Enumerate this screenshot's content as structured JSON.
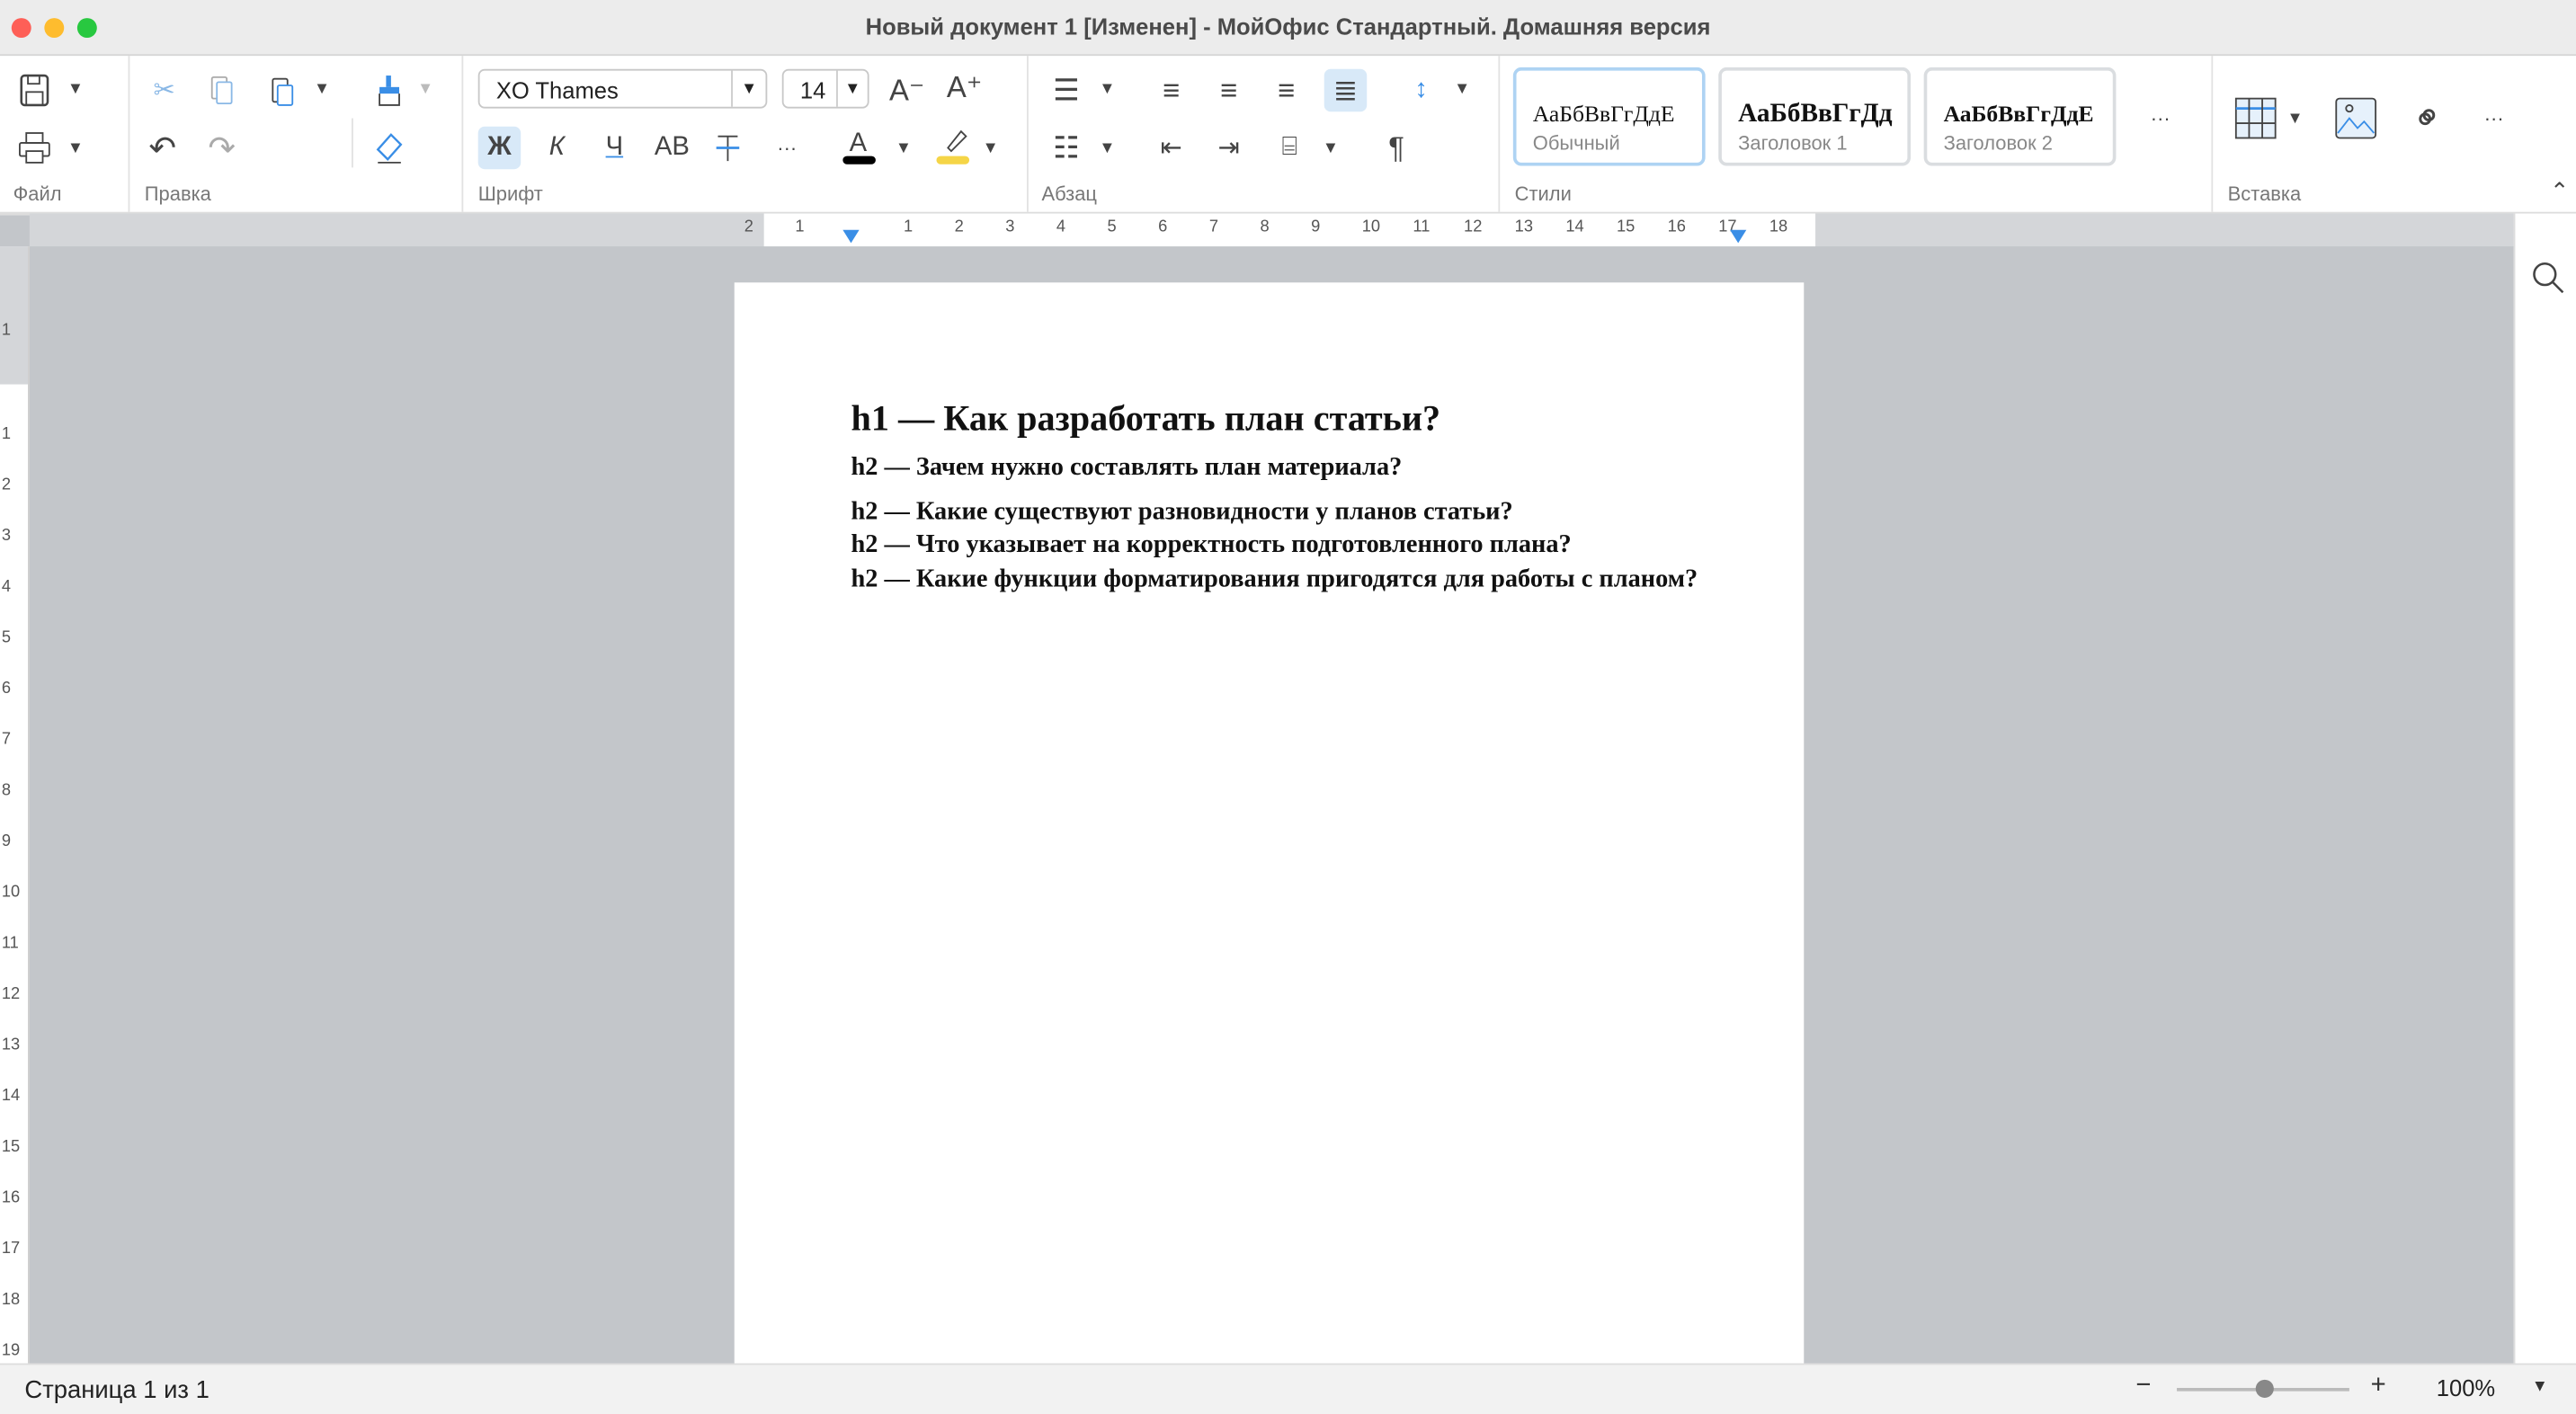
{
  "window": {
    "title": "Новый документ 1 [Изменен] - МойОфис Стандартный. Домашняя версия",
    "traffic_lights": [
      "#fe5f57",
      "#febc2e",
      "#28c840"
    ]
  },
  "toolbar": {
    "groups": {
      "file": "Файл",
      "edit": "Правка",
      "font": "Шрифт",
      "paragraph": "Абзац",
      "styles": "Стили",
      "insert": "Вставка"
    },
    "font_name": "XO Thames",
    "font_size": "14",
    "bold_label": "Ж",
    "italic_label": "К",
    "underline_label": "Ч",
    "caps_label": "АВ",
    "font_decrease": "A⁻",
    "font_increase": "A⁺",
    "more": "···",
    "styles": [
      {
        "preview": "АаБбВвГгДдЕ",
        "name": "Обычный",
        "selected": true
      },
      {
        "preview": "АаБбВвГгДд",
        "name": "Заголовок 1"
      },
      {
        "preview": "АаБбВвГгДдЕ",
        "name": "Заголовок 2"
      }
    ],
    "accent": "#3a8ee6",
    "highlight_color": "#f5d547",
    "text_color": "#000000"
  },
  "ruler": {
    "horizontal": [
      "2",
      "1",
      "1",
      "2",
      "3",
      "4",
      "5",
      "6",
      "7",
      "8",
      "9",
      "10",
      "11",
      "12",
      "13",
      "14",
      "15",
      "16",
      "17",
      "18"
    ],
    "vertical": [
      "1",
      "1",
      "2",
      "3",
      "4",
      "5",
      "6",
      "7",
      "8",
      "9",
      "10",
      "11",
      "12",
      "13",
      "14",
      "15",
      "16",
      "17",
      "18",
      "19"
    ]
  },
  "document": {
    "h1": "h1 — Как разработать план статьи?",
    "h2": [
      "h2 — Зачем нужно составлять план материала?",
      "h2 — Какие существуют разновидности у планов статьи?",
      "h2 — Что указывает на корректность подготовленного плана?",
      "h2 — Какие функции форматирования пригодятся для работы с планом?"
    ]
  },
  "status": {
    "page": "Страница 1 из 1",
    "zoom": "100%",
    "zoom_level_percent": 100
  }
}
